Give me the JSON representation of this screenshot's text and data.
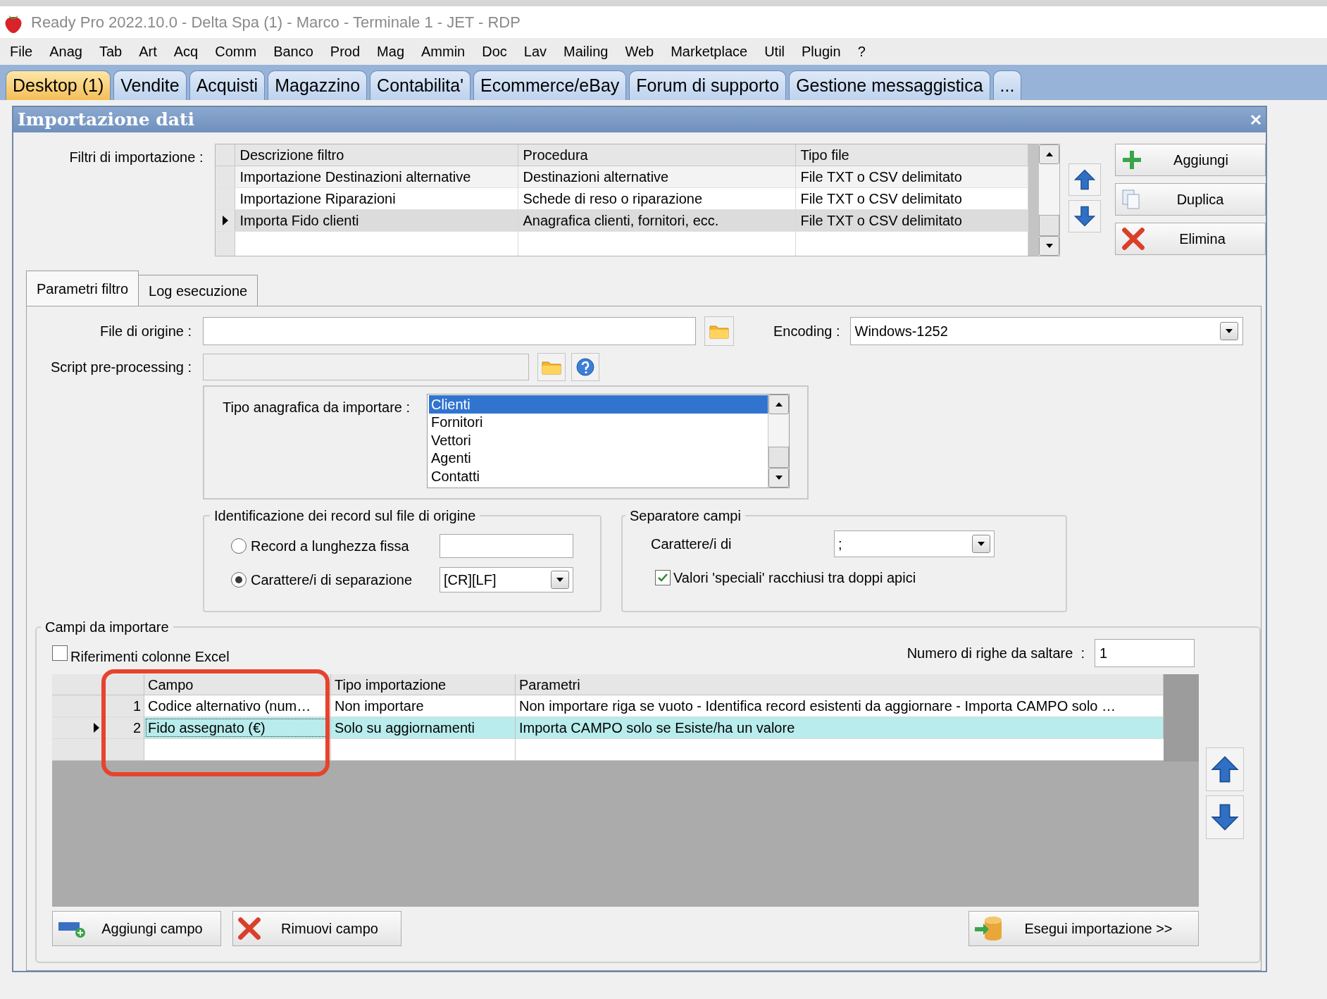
{
  "window": {
    "title": "Ready Pro 2022.10.0 - Delta Spa (1) - Marco - Terminale 1 - JET - RDP"
  },
  "menu": [
    "File",
    "Anag",
    "Tab",
    "Art",
    "Acq",
    "Comm",
    "Banco",
    "Prod",
    "Mag",
    "Ammin",
    "Doc",
    "Lav",
    "Mailing",
    "Web",
    "Marketplace",
    "Util",
    "Plugin",
    "?"
  ],
  "tabs": [
    {
      "label": "Desktop (1)",
      "selected": true
    },
    {
      "label": "Vendite",
      "selected": false
    },
    {
      "label": "Acquisti",
      "selected": false
    },
    {
      "label": "Magazzino",
      "selected": false
    },
    {
      "label": "Contabilita'",
      "selected": false
    },
    {
      "label": "Ecommerce/eBay",
      "selected": false
    },
    {
      "label": "Forum di supporto",
      "selected": false
    },
    {
      "label": "Gestione messaggistica",
      "selected": false
    },
    {
      "label": "...",
      "selected": false
    }
  ],
  "dialog": {
    "title": "Importazione dati"
  },
  "filters": {
    "label": "Filtri di importazione :",
    "columns": [
      "Descrizione filtro",
      "Procedura",
      "Tipo file"
    ],
    "rows": [
      {
        "cells": [
          "Importazione Destinazioni alternative",
          "Destinazioni alternative",
          "File TXT o CSV delimitato"
        ],
        "selected": false
      },
      {
        "cells": [
          "Importazione Riparazioni",
          "Schede di reso o riparazione",
          "File TXT o CSV delimitato"
        ],
        "selected": false
      },
      {
        "cells": [
          "Importa Fido clienti",
          "Anagrafica clienti, fornitori, ecc.",
          "File TXT o CSV delimitato"
        ],
        "selected": true
      }
    ]
  },
  "filter_buttons": [
    {
      "kind": "add",
      "label": "Aggiungi"
    },
    {
      "kind": "copy",
      "label": "Duplica"
    },
    {
      "kind": "delete",
      "label": "Elimina"
    }
  ],
  "sub_tabs": [
    {
      "label": "Parametri filtro",
      "selected": true
    },
    {
      "label": "Log esecuzione",
      "selected": false
    }
  ],
  "file_origin": {
    "label": "File di origine :"
  },
  "encoding": {
    "label": "Encoding :",
    "value": "Windows-1252"
  },
  "script": {
    "label": "Script pre-processing :",
    "disabled": true
  },
  "registry_type": {
    "label": "Tipo anagrafica da importare :",
    "options": [
      {
        "label": "Clienti",
        "selected": true
      },
      {
        "label": "Fornitori",
        "selected": false
      },
      {
        "label": "Vettori",
        "selected": false
      },
      {
        "label": "Agenti",
        "selected": false
      },
      {
        "label": "Contatti",
        "selected": false
      }
    ]
  },
  "record_id": {
    "title": "Identificazione dei record sul file di origine",
    "options": [
      {
        "label": "Record a lunghezza fissa",
        "selected": false,
        "kind": "text"
      },
      {
        "label": "Carattere/i di separazione",
        "selected": true,
        "kind": "select",
        "value": "[CR][LF]"
      }
    ]
  },
  "field_separator": {
    "title": "Separatore campi",
    "label": "Carattere/i di",
    "value": ";",
    "quoted": {
      "label": "Valori 'speciali' racchiusi tra doppi apici",
      "checked": true
    }
  },
  "fields": {
    "title": "Campi da importare",
    "excel_refs": {
      "label": "Riferimenti colonne Excel",
      "checked": false
    },
    "skip_rows": {
      "label": "Numero di righe da saltare  :",
      "value": "1"
    },
    "columns": [
      "Campo",
      "Tipo importazione",
      "Parametri"
    ],
    "rows": [
      {
        "number": "1",
        "cells": [
          "Codice alternativo (num…",
          "Non importare",
          "Non importare riga se vuoto - Identifica record esistenti da aggiornare - Importa CAMPO solo …"
        ],
        "selected": false
      },
      {
        "number": "2",
        "cells": [
          "Fido assegnato (€)",
          "Solo su aggiornamenti",
          "Importa CAMPO solo se Esiste/ha un valore"
        ],
        "selected": true
      }
    ]
  },
  "field_buttons": [
    {
      "kind": "add",
      "label": "Aggiungi campo"
    },
    {
      "kind": "remove",
      "label": "Rimuovi campo"
    },
    {
      "kind": "run",
      "label": "Esegui importazione >>"
    }
  ]
}
